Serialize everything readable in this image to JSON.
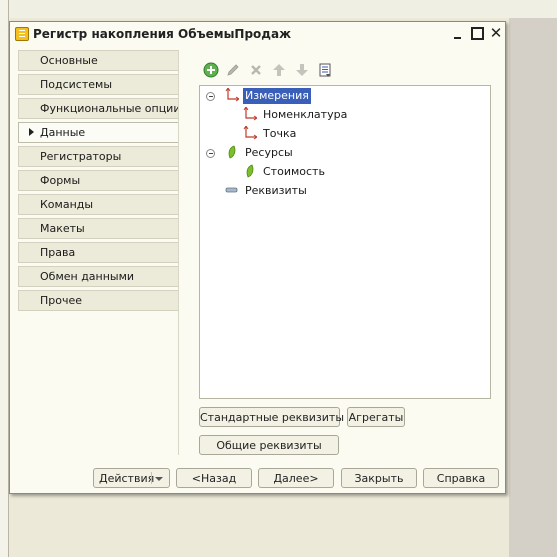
{
  "window": {
    "title": "Регистр накопления ОбъемыПродаж"
  },
  "tabs": [
    {
      "label": "Основные",
      "active": false
    },
    {
      "label": "Подсистемы",
      "active": false
    },
    {
      "label": "Функциональные опции",
      "active": false
    },
    {
      "label": "Данные",
      "active": true
    },
    {
      "label": "Регистраторы",
      "active": false
    },
    {
      "label": "Формы",
      "active": false
    },
    {
      "label": "Команды",
      "active": false
    },
    {
      "label": "Макеты",
      "active": false
    },
    {
      "label": "Права",
      "active": false
    },
    {
      "label": "Обмен данными",
      "active": false
    },
    {
      "label": "Прочее",
      "active": false
    }
  ],
  "toolbar_icons": [
    "add-icon",
    "edit-icon",
    "delete-icon",
    "move-up-icon",
    "move-down-icon",
    "list-icon"
  ],
  "tree": {
    "dimensions": {
      "label": "Измерения",
      "selected": true
    },
    "dim_items": [
      "Номенклатура",
      "Точка"
    ],
    "resources": {
      "label": "Ресурсы"
    },
    "res_items": [
      "Стоимость"
    ],
    "attributes": {
      "label": "Реквизиты"
    }
  },
  "buttons": {
    "standard_attrs": "Стандартные реквизиты",
    "aggregates": "Агрегаты",
    "common_attrs": "Общие реквизиты",
    "actions": "Действия",
    "back": "<Назад",
    "next": "Далее>",
    "close": "Закрыть",
    "help": "Справка"
  },
  "colors": {
    "selection": "#3a5fb8",
    "dimension_icon": "#c0392b",
    "resource_icon": "#7bbf2a",
    "add_icon": "#4caf50"
  }
}
